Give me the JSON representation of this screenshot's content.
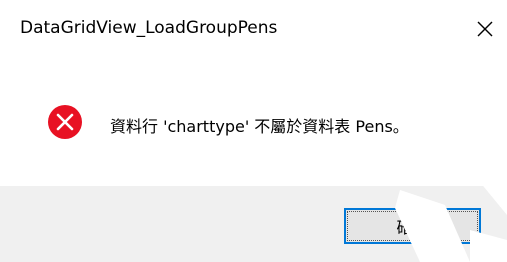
{
  "window": {
    "title": "DataGridView_LoadGroupPens",
    "close_glyph": "✕"
  },
  "message": {
    "icon": "error-icon",
    "text": "資料行 'charttype' 不屬於資料表 Pens。"
  },
  "buttons": {
    "ok_label": "確定"
  },
  "colors": {
    "error_red": "#e81123",
    "focus_border": "#0078d7",
    "footer_bg": "#f0f0f0"
  }
}
